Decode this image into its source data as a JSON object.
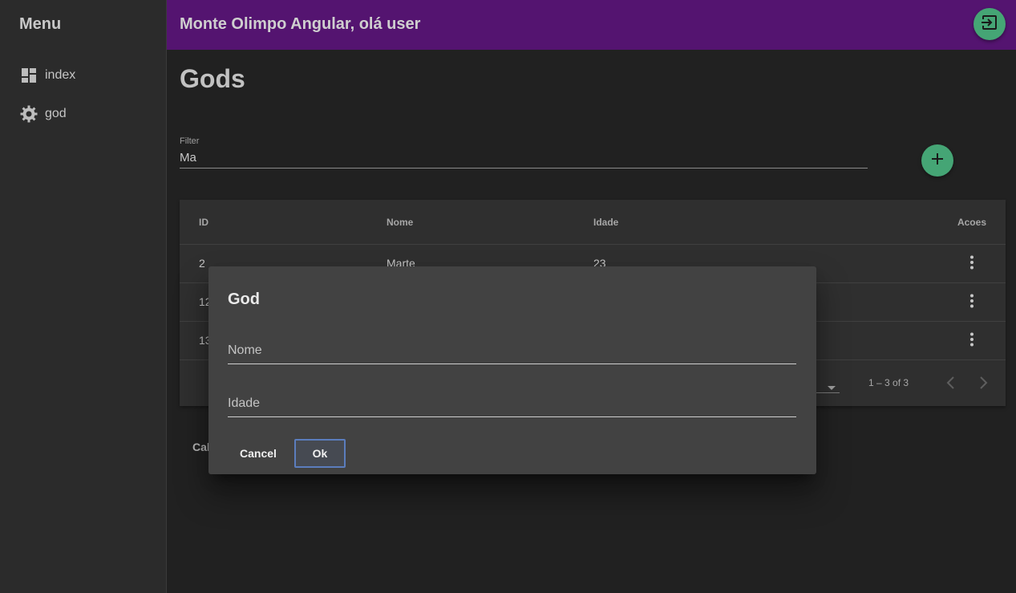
{
  "sidebar": {
    "title": "Menu",
    "items": [
      {
        "label": "index",
        "icon": "dashboard-icon"
      },
      {
        "label": "god",
        "icon": "gear-icon"
      }
    ]
  },
  "header": {
    "title": "Monte Olimpo Angular, olá user",
    "logout_icon": "logout-icon"
  },
  "main": {
    "page_title": "Gods",
    "filter": {
      "label": "Filter",
      "value": "Ma"
    },
    "add_icon": "add-icon",
    "table": {
      "headers": [
        "ID",
        "Nome",
        "Idade",
        "Acoes"
      ],
      "rows": [
        {
          "id": "2",
          "nome": "Marte",
          "idade": "23"
        },
        {
          "id": "12",
          "nome": "",
          "idade": ""
        },
        {
          "id": "13",
          "nome": "",
          "idade": ""
        }
      ]
    },
    "paginator": {
      "range": "1 – 3 of 3"
    },
    "under_text": "Cal"
  },
  "dialog": {
    "title": "God",
    "nome_placeholder": "Nome",
    "idade_placeholder": "Idade",
    "cancel_label": "Cancel",
    "ok_label": "Ok"
  },
  "colors": {
    "toolbar": "#541470",
    "accent": "#45a575",
    "background": "#212121",
    "sidebar": "#2b2b2b",
    "dialog": "#424242"
  }
}
